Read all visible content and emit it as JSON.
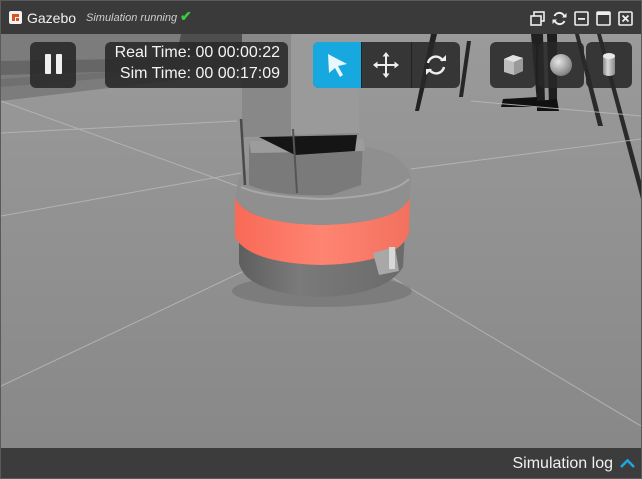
{
  "window": {
    "title": "Gazebo",
    "status_text": "Simulation running",
    "status_icon": "checkmark-icon",
    "title_buttons": [
      "restore-icon",
      "refresh-icon",
      "minimize-icon",
      "maximize-icon",
      "close-icon"
    ]
  },
  "viewport": {
    "pause_icon": "pause-icon",
    "time": {
      "real_label": "Real Time: 00 00:00:22",
      "sim_label": "Sim Time: 00 00:17:09"
    },
    "tools": [
      {
        "name": "select",
        "icon": "arrow-cursor-icon",
        "active": true
      },
      {
        "name": "translate",
        "icon": "move-arrows-icon",
        "active": false
      },
      {
        "name": "rotate",
        "icon": "rotate-icon",
        "active": false
      }
    ],
    "shapes": [
      {
        "name": "box",
        "icon": "cube-icon"
      },
      {
        "name": "sphere",
        "icon": "sphere-icon"
      },
      {
        "name": "cylinder",
        "icon": "cylinder-icon"
      }
    ]
  },
  "statusbar": {
    "log_label": "Simulation log",
    "expand_icon": "chevron-up-icon"
  },
  "colors": {
    "accent": "#16a8de",
    "ground": "#8c8c8c",
    "robot_band": "#ff7b66",
    "status_ok": "#3cc83c"
  }
}
